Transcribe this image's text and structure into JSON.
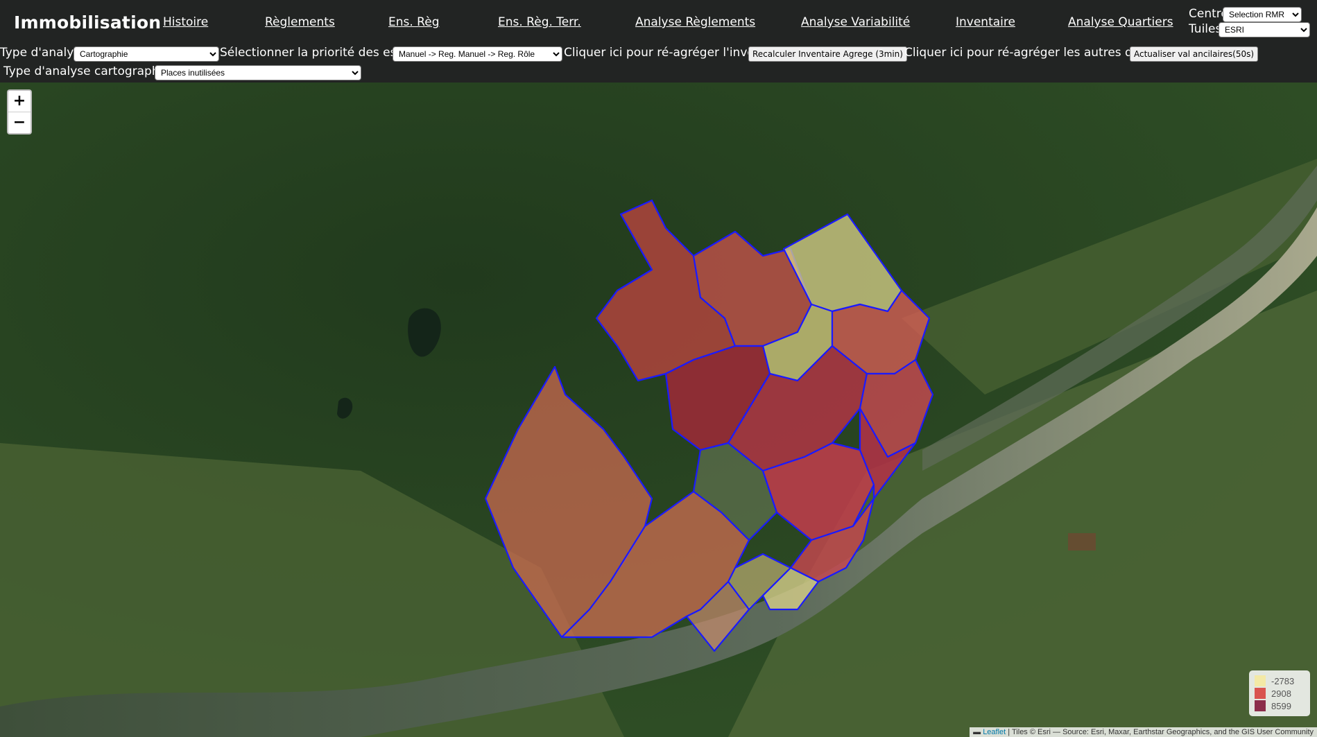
{
  "header": {
    "title": "Immobilisation",
    "nav": [
      "Histoire",
      "Règlements",
      "Ens. Règ",
      "Ens. Règ. Terr.",
      "Analyse Règlements",
      "Analyse Variabilité",
      "Inventaire",
      "Analyse Quartiers"
    ],
    "centre_label": "Centre",
    "centre_value": "Selection RMR",
    "tuiles_label": "Tuiles",
    "tuiles_value": "ESRI"
  },
  "controls": {
    "analysis_type_label": "Type d'analyse",
    "analysis_type_value": "Cartographie",
    "priority_label": "Sélectionner la priorité des estimés",
    "priority_value": "Manuel -> Reg. Manuel -> Reg. Rôle",
    "reaggregate_label": "Cliquer ici pour ré-agréger l'inventaire",
    "reaggregate_button": "Recalculer Inventaire Agrege (3min)",
    "other_data_label": "Cliquer ici pour ré-agréger les autres données",
    "other_data_button": "Actualiser val ancilaires(50s)",
    "carto_type_label": "Type d'analyse cartographique",
    "carto_type_value": "Places inutilisées"
  },
  "map": {
    "zoom_in": "+",
    "zoom_out": "−",
    "legend": [
      {
        "label": "-2783",
        "color": "#f3e9a6"
      },
      {
        "label": "2908",
        "color": "#d9534f"
      },
      {
        "label": "8599",
        "color": "#8c2d4a"
      }
    ],
    "attribution_leaflet": "Leaflet",
    "attribution_rest": " | Tiles © Esri — Source: Esri, Maxar, Earthstar Geographics, and the GIS User Community"
  }
}
